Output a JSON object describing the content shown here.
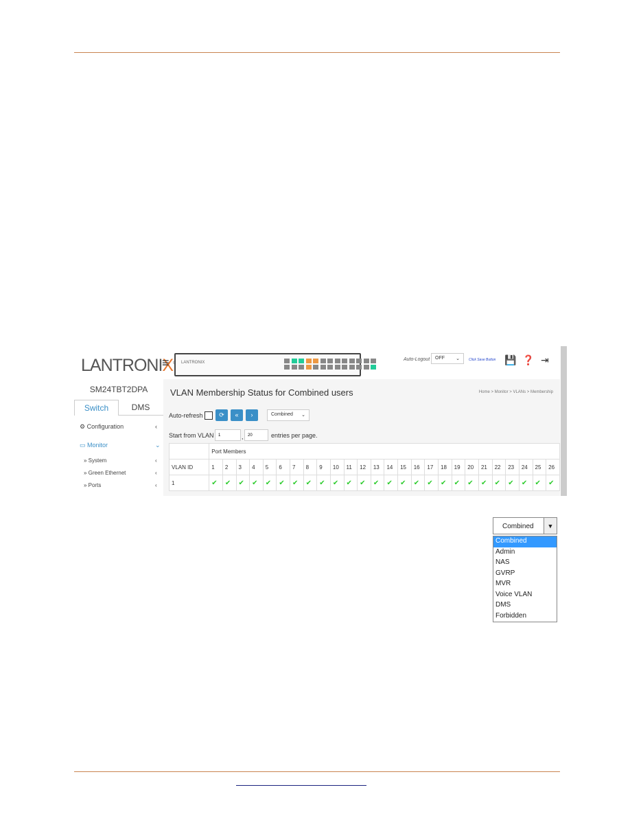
{
  "header": {
    "logo": "LANTRONIX",
    "panel_logo": "LANTRONIX",
    "auto_logout_label": "Auto-Logout",
    "auto_logout_value": "OFF",
    "click_save": "Click Save Button"
  },
  "sidebar": {
    "device": "SM24TBT2DPA",
    "tabs": [
      "Switch",
      "DMS"
    ],
    "items": [
      {
        "label": "Configuration"
      },
      {
        "label": "Monitor"
      },
      {
        "label": "» System"
      },
      {
        "label": "» Green Ethernet"
      },
      {
        "label": "» Ports"
      }
    ]
  },
  "main": {
    "title": "VLAN Membership Status for Combined users",
    "breadcrumb": "Home > Monitor > VLANs > Membership",
    "auto_refresh": "Auto-refresh",
    "user_select": "Combined",
    "start_label": "Start from VLAN",
    "start_value": "1",
    "comma": ",",
    "entries_value": "20",
    "entries_label": "entries per page.",
    "table": {
      "group_header": "Port Members",
      "vlan_header": "VLAN ID",
      "ports": [
        "1",
        "2",
        "3",
        "4",
        "5",
        "6",
        "7",
        "8",
        "9",
        "10",
        "11",
        "12",
        "13",
        "14",
        "15",
        "16",
        "17",
        "18",
        "19",
        "20",
        "21",
        "22",
        "23",
        "24",
        "25",
        "26"
      ],
      "rows": [
        {
          "vlan": "1",
          "members": "all"
        }
      ]
    }
  },
  "dropdown": {
    "selected": "Combined",
    "options": [
      "Combined",
      "Admin",
      "NAS",
      "GVRP",
      "MVR",
      "Voice VLAN",
      "DMS",
      "Forbidden"
    ]
  },
  "colors": {
    "accent": "#3a8fc7",
    "check": "#2ecc2e",
    "rule": "#c9834f"
  }
}
